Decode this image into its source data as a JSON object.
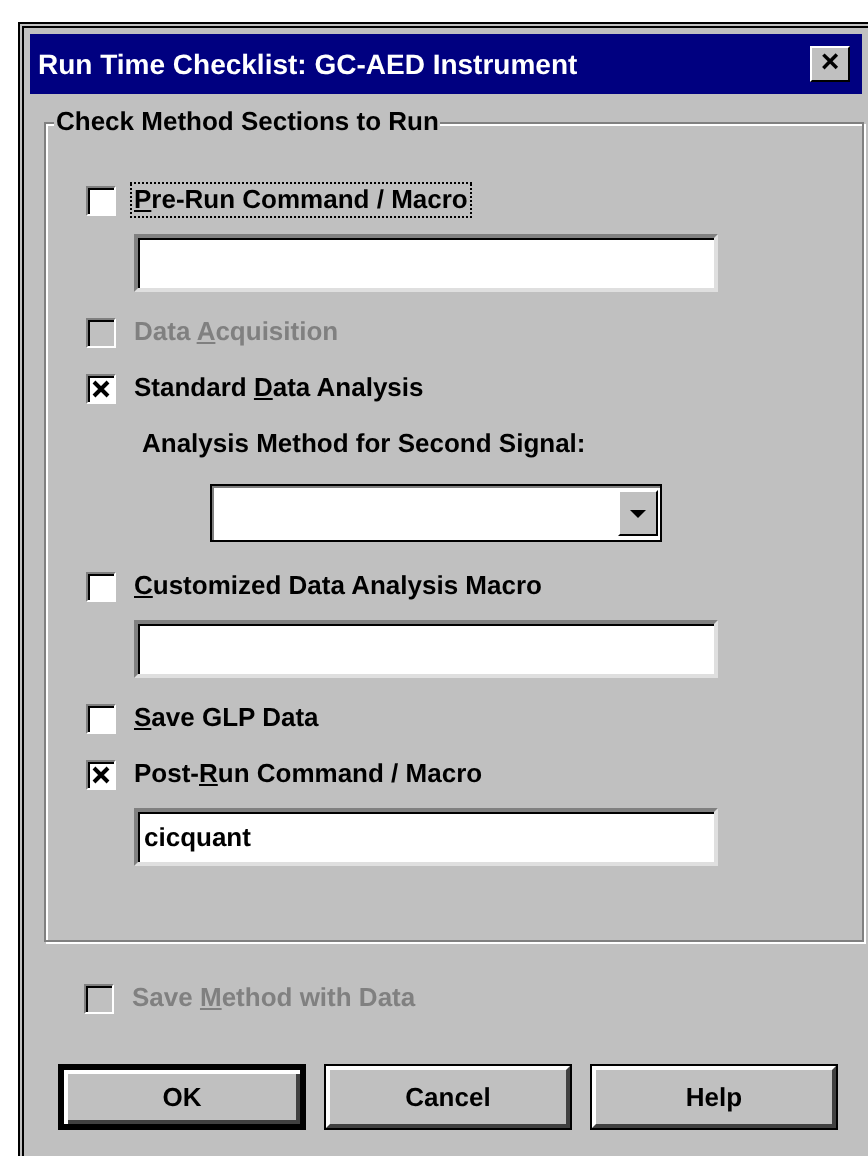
{
  "window": {
    "title": "Run Time Checklist: GC-AED Instrument",
    "close": "×"
  },
  "group": {
    "title": "Check Method Sections to Run",
    "items": [
      {
        "kind": "checkbox",
        "access_key": "P",
        "label_after": "re-Run Command / Macro",
        "checked": false,
        "disabled": false,
        "focused": true
      },
      {
        "kind": "field",
        "value": ""
      },
      {
        "kind": "checkbox",
        "label_before": "Data ",
        "access_key": "A",
        "label_after": "cquisition",
        "checked": false,
        "disabled": true,
        "focused": false
      },
      {
        "kind": "checkbox",
        "label_before": "Standard ",
        "access_key": "D",
        "label_after": "ata Analysis",
        "checked": true,
        "disabled": false,
        "focused": false
      },
      {
        "kind": "label",
        "label": "Analysis Method for Second Signal:"
      },
      {
        "kind": "dropdown",
        "value": ""
      },
      {
        "kind": "checkbox",
        "access_key": "C",
        "label_after": "ustomized Data Analysis Macro",
        "checked": false,
        "disabled": false,
        "focused": false
      },
      {
        "kind": "field",
        "value": ""
      },
      {
        "kind": "checkbox",
        "access_key": "S",
        "label_after": "ave GLP Data",
        "checked": false,
        "disabled": false,
        "focused": false
      },
      {
        "kind": "checkbox",
        "label_before": "Post-",
        "access_key": "R",
        "label_after": "un Command / Macro",
        "checked": true,
        "disabled": false,
        "focused": false
      },
      {
        "kind": "field",
        "value": "cicquant"
      }
    ]
  },
  "save_method": {
    "label_before": "Save ",
    "access_key": "M",
    "label_after": "ethod with Data",
    "checked": false,
    "disabled": true
  },
  "buttons": [
    {
      "label": "OK",
      "default": true
    },
    {
      "label": "Cancel",
      "default": false
    },
    {
      "label": "Help",
      "default": false
    }
  ]
}
